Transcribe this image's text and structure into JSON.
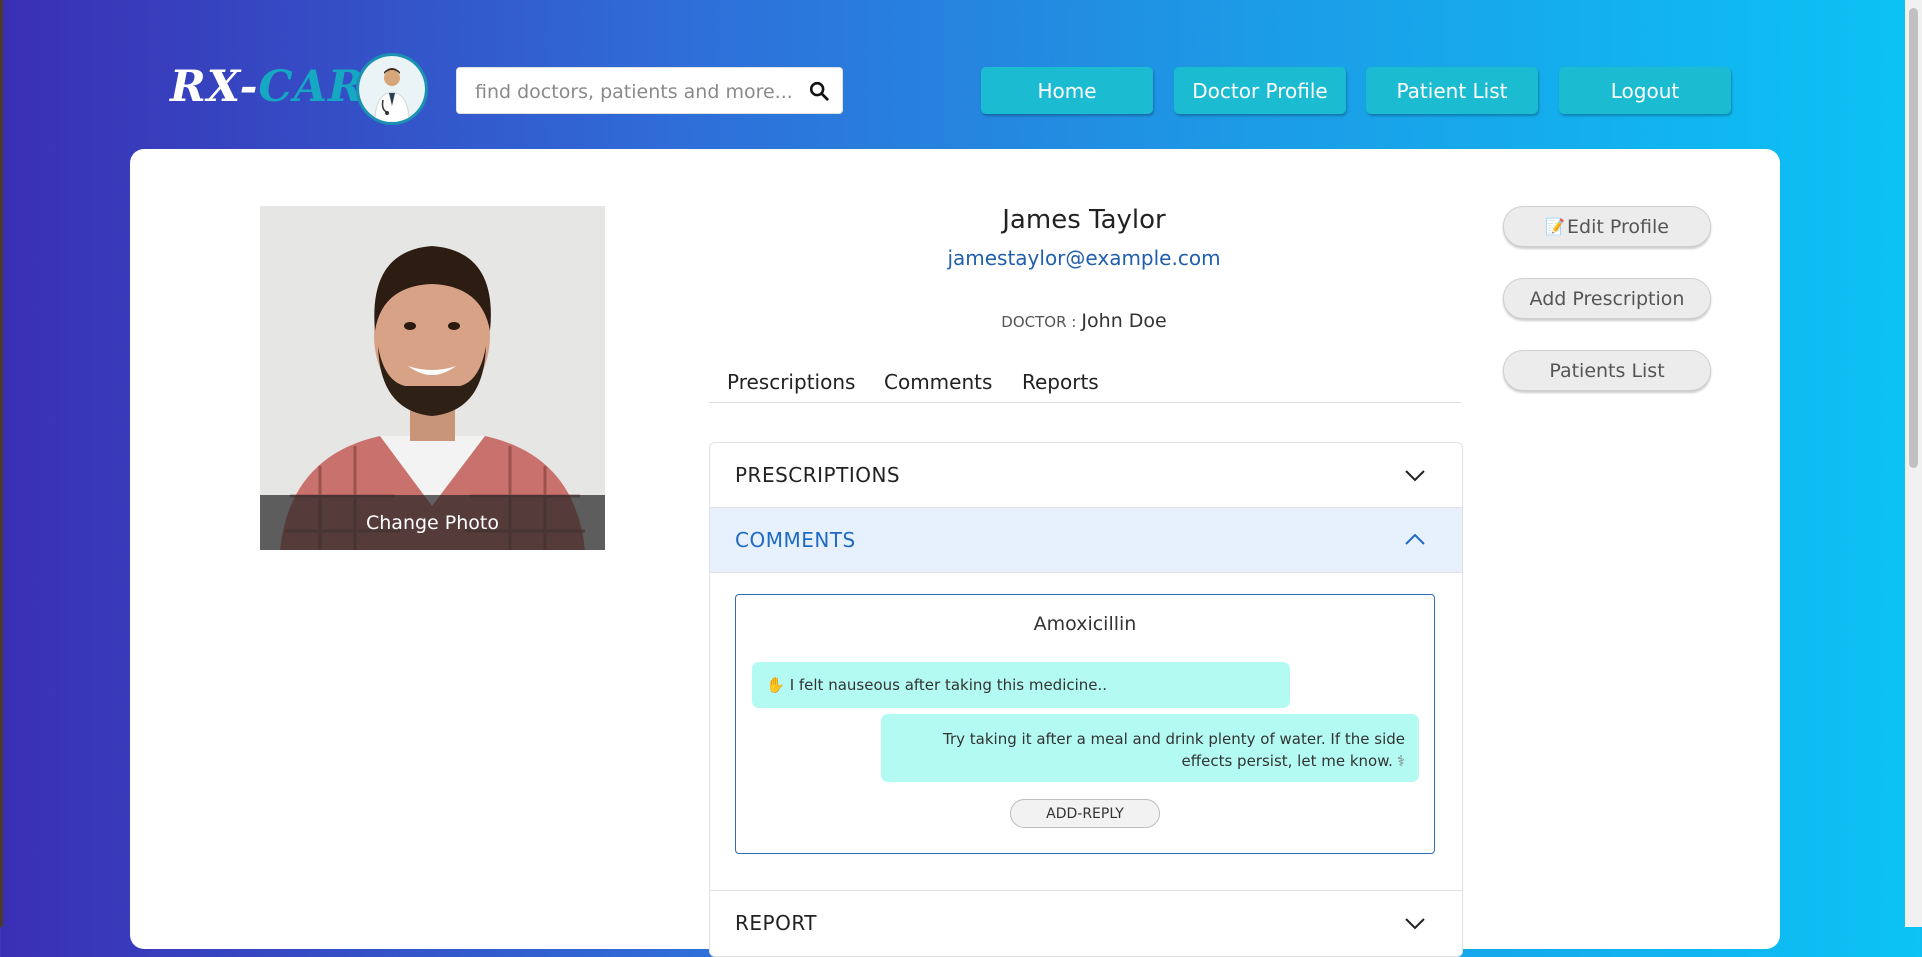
{
  "header": {
    "logo_rx": "RX-",
    "logo_care": "CARE",
    "search_placeholder": "find doctors, patients and more...",
    "nav": [
      {
        "label": "Home"
      },
      {
        "label": "Doctor Profile"
      },
      {
        "label": "Patient List"
      },
      {
        "label": "Logout"
      }
    ]
  },
  "profile": {
    "change_photo_label": "Change Photo",
    "name": "James Taylor",
    "email": "jamestaylor@example.com",
    "doctor_label": "DOCTOR :",
    "doctor_name": "John Doe"
  },
  "tabs": [
    {
      "label": "Prescriptions"
    },
    {
      "label": "Comments"
    },
    {
      "label": "Reports"
    }
  ],
  "accordion": {
    "prescriptions_title": "PRESCRIPTIONS",
    "comments_title": "COMMENTS",
    "report_title": "REPORT",
    "comment_thread": {
      "medicine": "Amoxicillin",
      "patient_message": "I felt nauseous after taking this medicine..",
      "doctor_reply": "Try taking it after a meal and drink plenty of water. If the side effects persist, let me know.",
      "add_reply_label": "ADD-REPLY"
    }
  },
  "side_actions": {
    "edit_profile": "Edit Profile",
    "add_prescription": "Add Prescription",
    "patients_list": "Patients List"
  },
  "colors": {
    "nav_button": "#1bbcd2",
    "accent_blue": "#1f6ac4",
    "bubble": "#b3fbf2"
  },
  "icons": {
    "search": "search-icon",
    "chevron": "chevron-icon",
    "hand": "hand-icon",
    "stethoscope": "stethoscope-icon",
    "pencil": "pencil-icon"
  }
}
